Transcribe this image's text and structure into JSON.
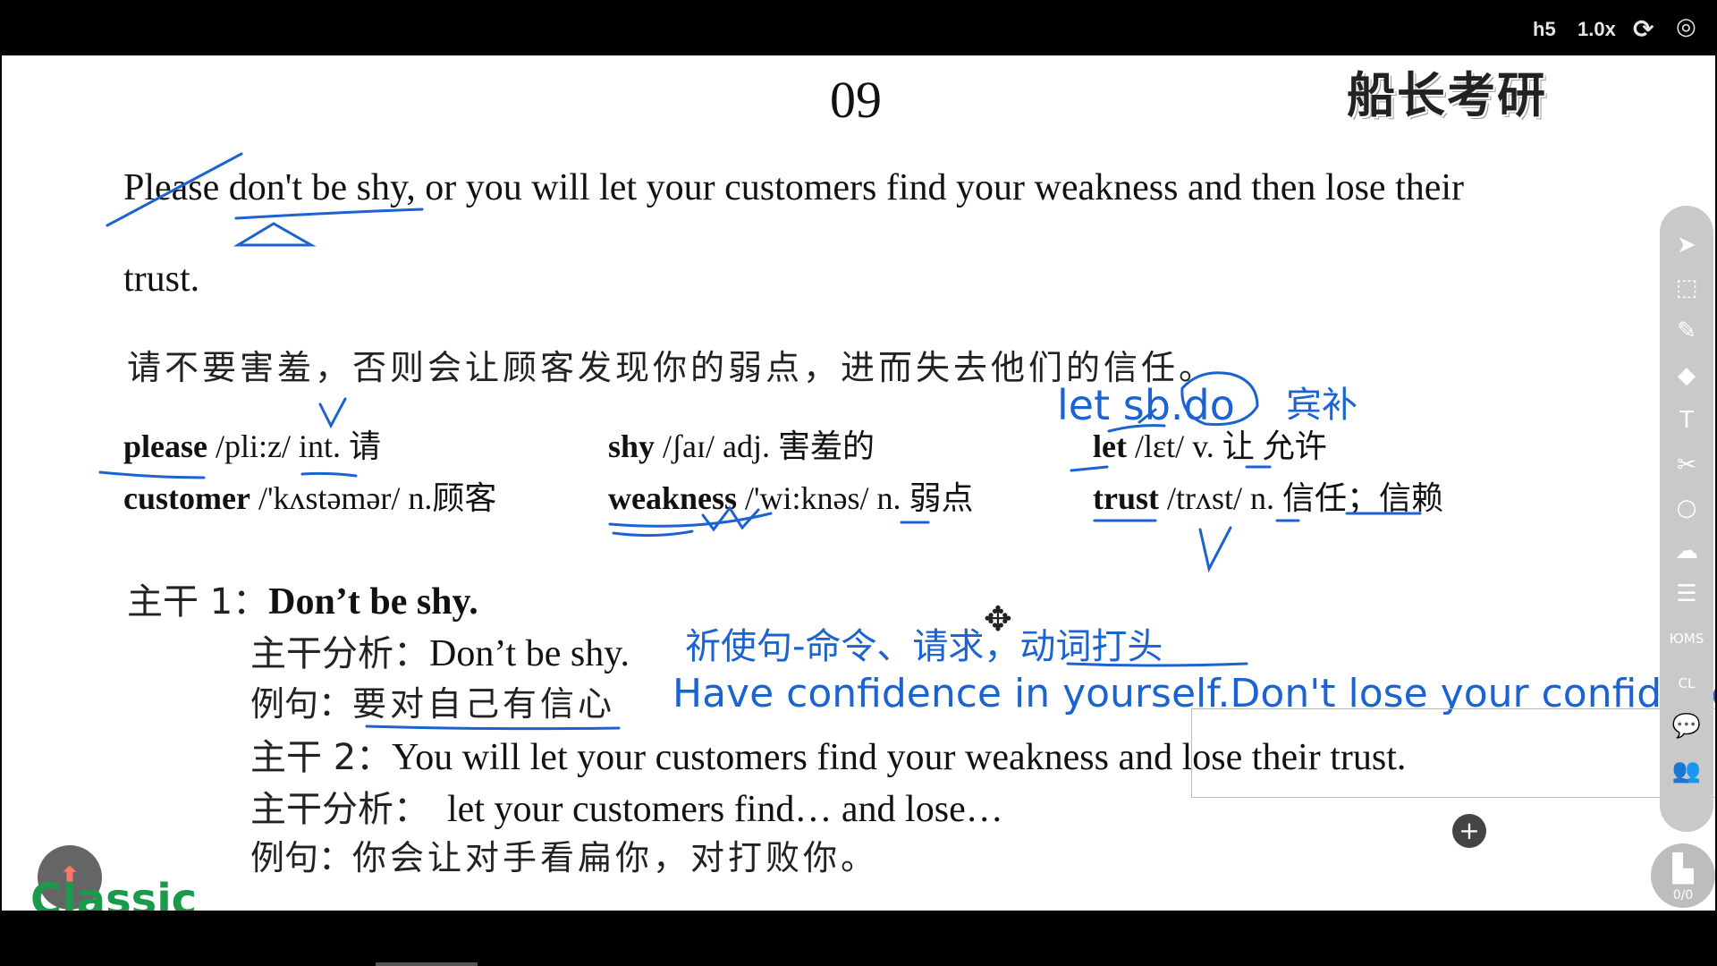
{
  "player": {
    "quality": "h5",
    "speed": "1.0x",
    "icons": [
      "replay-icon",
      "record-icon"
    ]
  },
  "slide": {
    "page_number": "09",
    "brand": "船长考研",
    "sentence_line1": "Please don't be shy, or you will let your customers find your weakness and then lose their",
    "sentence_line2": "trust.",
    "translation": "请不要害羞，否则会让顾客发现你的弱点，进而失去他们的信任。",
    "vocab": [
      {
        "word": "please",
        "rest": " /pli:z/ int.  请"
      },
      {
        "word": "shy",
        "rest": " /ʃaɪ/ adj.  害羞的"
      },
      {
        "word": "let",
        "rest": " /lɛt/ v.  让  允许"
      },
      {
        "word": "customer",
        "rest": " /'kʌstəmər/ n.顾客"
      },
      {
        "word": "weakness",
        "rest": " /'wi:knəs/ n.  弱点"
      },
      {
        "word": "trust",
        "rest": " /trʌst/ n.  信任；信赖"
      }
    ],
    "main1_label": "主干 1：",
    "main1_text": "Don’t be shy.",
    "analysis1_label": "主干分析：",
    "analysis1_text": "Don’t be shy.",
    "example1_label": "例句：",
    "example1_text": "要对自己有信心",
    "main2_label": "主干 2：",
    "main2_text": "You will let your customers find your weakness and lose their trust.",
    "analysis2_label": "主干分析：",
    "analysis2_text": "let your customers find… and lose…",
    "example2_label": "例句：",
    "example2_text": "你会让对手看扁你，对打败你。"
  },
  "annotations": {
    "let_sb_do": "let sb.do",
    "binbu": "宾补",
    "imperative": "祈使句-命令、请求，动词打头",
    "example_en": "Have confidence in yourself.Don't lose your confidence."
  },
  "toolbar": {
    "tools": [
      "cursor-icon",
      "select-icon",
      "pen-icon",
      "eraser-icon",
      "text-icon",
      "scissors-icon",
      "circle-icon",
      "cloud-icon",
      "layers-icon",
      "mark-icon",
      "clear-icon",
      "chat-icon",
      "users-icon"
    ],
    "mark_label": "ЮМS",
    "clear_label": "CL"
  },
  "pager": {
    "count": "0/0"
  },
  "watermark": "Classic"
}
